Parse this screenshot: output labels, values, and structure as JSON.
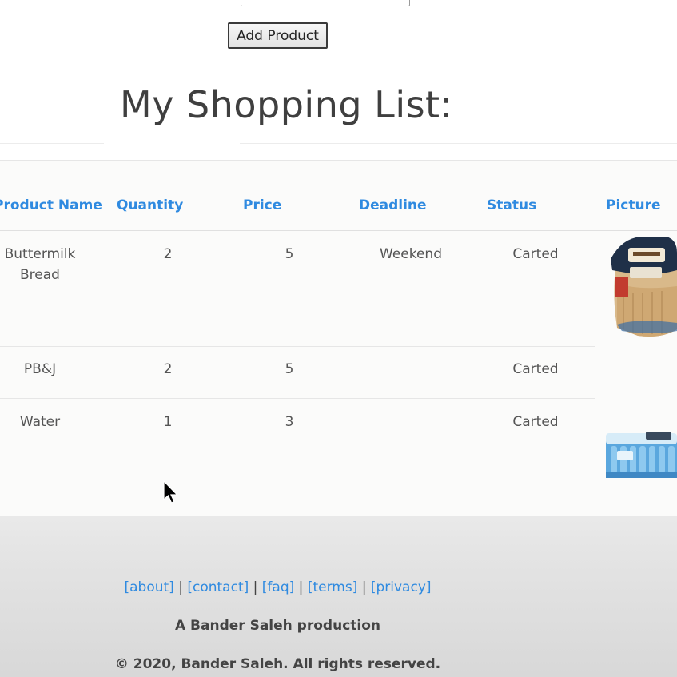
{
  "form": {
    "add_button_label": "Add Product"
  },
  "page": {
    "title": "My Shopping List:"
  },
  "table": {
    "headers": [
      "Product Name",
      "Quantity",
      "Price",
      "Deadline",
      "Status",
      "Picture"
    ],
    "rows": [
      {
        "name_line1": "Buttermilk",
        "name_line2": "Bread",
        "quantity": "2",
        "price": "5",
        "deadline": "Weekend",
        "status": "Carted",
        "picture": "buttermilk-bread-image"
      },
      {
        "name_line1": "PB&J",
        "name_line2": "",
        "quantity": "2",
        "price": "5",
        "deadline": "",
        "status": "Carted",
        "picture": ""
      },
      {
        "name_line1": "Water",
        "name_line2": "",
        "quantity": "1",
        "price": "3",
        "deadline": "",
        "status": "Carted",
        "picture": "water-bottles-image"
      }
    ]
  },
  "footer": {
    "links": [
      "[about]",
      "[contact]",
      "[faq]",
      "[terms]",
      "[privacy]"
    ],
    "separator": " | ",
    "credit": "A Bander Saleh production",
    "copyright": "© 2020, Bander Saleh. All rights reserved."
  },
  "colors": {
    "link": "#2f8ae0",
    "text": "#444444"
  }
}
